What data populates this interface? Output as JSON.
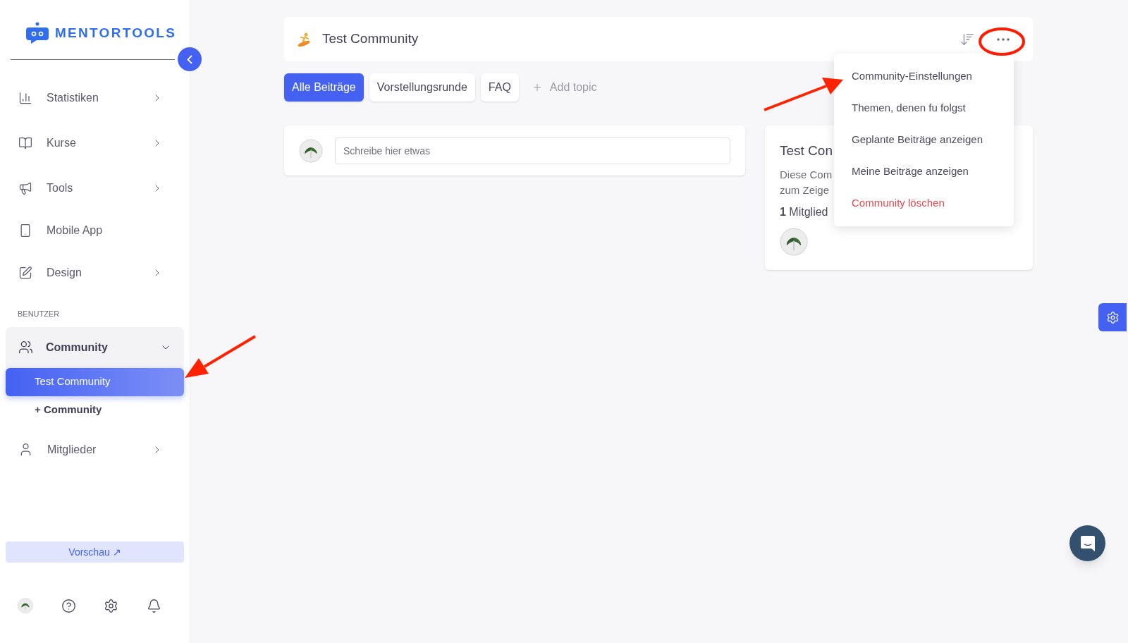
{
  "sidebar": {
    "logo": "MENTORTOOLS",
    "items": [
      {
        "label": "Statistiken",
        "kind": "group"
      },
      {
        "label": "Kurse",
        "kind": "group"
      },
      {
        "label": "Tools",
        "kind": "group"
      },
      {
        "label": "Mobile App",
        "kind": "link"
      },
      {
        "label": "Design",
        "kind": "group"
      }
    ],
    "section_label": "BENUTZER",
    "community": {
      "label": "Community",
      "expanded": true,
      "children": [
        {
          "label": "Test Community",
          "selected": true
        },
        {
          "label": "+ Community",
          "selected": false
        }
      ]
    },
    "members": {
      "label": "Mitglieder"
    },
    "preview_button": "Vorschau ↗"
  },
  "header": {
    "title": "Test Community"
  },
  "topics": [
    {
      "label": "Alle Beiträge",
      "selected": true
    },
    {
      "label": "Vorstellungsrunde",
      "selected": false
    },
    {
      "label": "FAQ",
      "selected": false
    }
  ],
  "add_topic": "Add topic",
  "composer": {
    "placeholder": "Schreibe hier etwas"
  },
  "info_card": {
    "title": "Test Con",
    "description_lines": [
      "Diese Com",
      "zum Zeige"
    ],
    "member_count": "1",
    "member_label": "Mitglied"
  },
  "menu": [
    {
      "label": "Community-Einstellungen",
      "kind": "normal"
    },
    {
      "label": "Themen, denen fu folgst",
      "kind": "normal"
    },
    {
      "label": "Geplante Beiträge anzeigen",
      "kind": "normal"
    },
    {
      "label": "Meine Beiträge anzeigen",
      "kind": "normal"
    },
    {
      "label": "Community löschen",
      "kind": "danger"
    }
  ]
}
